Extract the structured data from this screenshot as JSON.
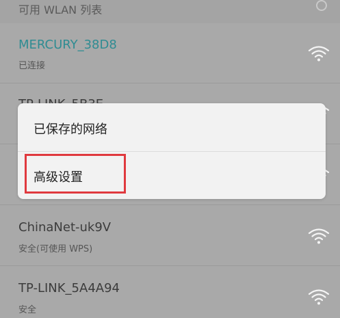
{
  "header": {
    "title": "可用 WLAN 列表",
    "spinner_icon": "loading-spinner-icon"
  },
  "networks": [
    {
      "ssid": "MERCURY_38D8",
      "status": "已连接",
      "icon": "wifi-signal-icon",
      "connected": true
    },
    {
      "ssid": "TP-LINK_5B3E",
      "status": "",
      "icon": "wifi-signal-icon",
      "connected": false
    },
    {
      "ssid": "",
      "status": "",
      "icon": "wifi-signal-icon",
      "connected": false
    },
    {
      "ssid": "ChinaNet-uk9V",
      "status": "安全(可使用 WPS)",
      "icon": "wifi-signal-icon",
      "connected": false
    },
    {
      "ssid": "TP-LINK_5A4A94",
      "status": "安全",
      "icon": "wifi-signal-icon",
      "connected": false
    }
  ],
  "menu": {
    "items": [
      {
        "label": "已保存的网络"
      },
      {
        "label": "高级设置"
      }
    ]
  },
  "colors": {
    "connected_ssid": "#2f8c92",
    "highlight": "#e0393e",
    "overlay_background": "#a9a9a9",
    "dialog_background": "#f2f2f2"
  }
}
